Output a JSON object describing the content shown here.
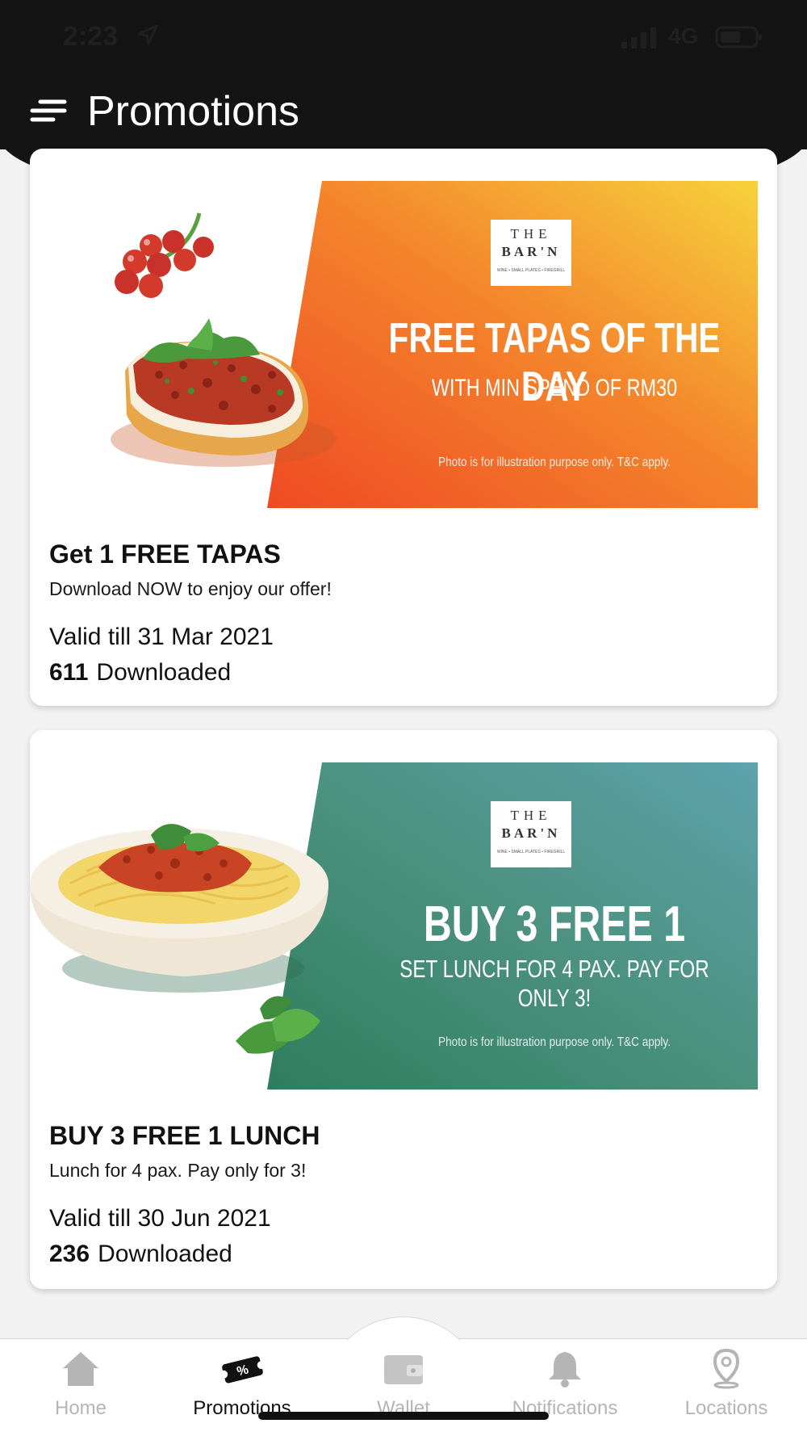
{
  "status_bar": {
    "time": "2:23",
    "network": "4G"
  },
  "header": {
    "title": "Promotions"
  },
  "promotions": [
    {
      "banner": {
        "logo_line1": "THE",
        "logo_line2": "BAR'N",
        "logo_line3": "WINE • SMALL PLATES • FIREGRILL",
        "headline": "FREE TAPAS OF THE DAY",
        "subline": "WITH MIN SPEND OF RM30",
        "disclaimer": "Photo is for illustration purpose only. T&C apply.",
        "gradient_start": "#ef4a23",
        "gradient_end": "#f6d23c"
      },
      "title": "Get 1 FREE TAPAS",
      "description": "Download NOW to enjoy our offer!",
      "valid": "Valid till 31 Mar 2021",
      "download_count": "611",
      "download_label": "Downloaded"
    },
    {
      "banner": {
        "logo_line1": "THE",
        "logo_line2": "BAR'N",
        "logo_line3": "WINE • SMALL PLATES • FIREGRILL",
        "headline": "BUY 3 FREE 1",
        "subline": "SET LUNCH FOR 4 PAX. PAY FOR ONLY 3!",
        "disclaimer": "Photo is for illustration purpose only. T&C apply.",
        "gradient_start": "#2f7d5e",
        "gradient_end": "#5ea2ad"
      },
      "title": "BUY 3 FREE 1 LUNCH",
      "description": "Lunch for 4 pax. Pay only for 3!",
      "valid": "Valid till 30 Jun 2021",
      "download_count": "236",
      "download_label": "Downloaded"
    }
  ],
  "tabbar": {
    "items": [
      {
        "label": "Home",
        "icon": "home-icon"
      },
      {
        "label": "Promotions",
        "icon": "ticket-percent-icon",
        "active": true
      },
      {
        "label": "Wallet",
        "icon": "wallet-icon"
      },
      {
        "label": "Notifications",
        "icon": "bell-icon"
      },
      {
        "label": "Locations",
        "icon": "map-pin-icon"
      }
    ]
  },
  "colors": {
    "header_bg": "#141414",
    "page_bg": "#f2f2f2",
    "tab_inactive": "#b5b5b5"
  }
}
